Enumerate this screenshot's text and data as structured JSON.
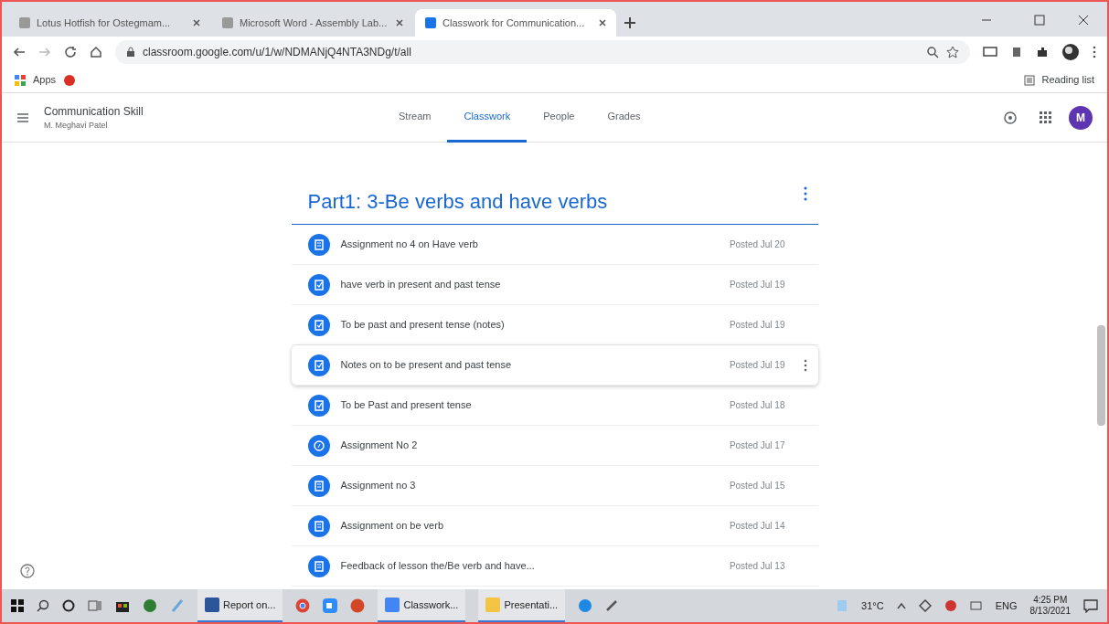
{
  "browser": {
    "tabs": [
      {
        "title": "Lotus Hotfish for Ostegmam...",
        "selected": false
      },
      {
        "title": "Microsoft Word - Assembly Lab...",
        "selected": false
      },
      {
        "title": "Classwork for Communication...",
        "selected": true
      }
    ],
    "url": "classroom.google.com/u/1/w/NDMANjQ4NTA3NDg/t/all",
    "bookmarks": [
      {
        "label": "Apps"
      }
    ],
    "reading_list": "Reading list"
  },
  "class": {
    "title": "Communication Skill",
    "subtitle": "M. Meghavi Patel",
    "avatar": "M",
    "tabs": [
      {
        "label": "Stream",
        "selected": false
      },
      {
        "label": "Classwork",
        "selected": true
      },
      {
        "label": "People",
        "selected": false
      },
      {
        "label": "Grades",
        "selected": false
      }
    ]
  },
  "topic": {
    "title": "Part1: 3-Be verbs and have verbs",
    "items": [
      {
        "kind": "assignment",
        "title": "Assignment no 4 on Have verb",
        "posted": "Posted Jul 20",
        "highlighted": false
      },
      {
        "kind": "material",
        "title": "have verb in present and past tense",
        "posted": "Posted Jul 19",
        "highlighted": false
      },
      {
        "kind": "material",
        "title": "To be past and present tense (notes)",
        "posted": "Posted Jul 19",
        "highlighted": false
      },
      {
        "kind": "material",
        "title": "Notes on to be present and past tense",
        "posted": "Posted Jul 19",
        "highlighted": true
      },
      {
        "kind": "material",
        "title": "To be Past and present tense",
        "posted": "Posted Jul 18",
        "highlighted": false
      },
      {
        "kind": "question",
        "title": "Assignment No 2",
        "posted": "Posted Jul 17",
        "highlighted": false
      },
      {
        "kind": "assignment",
        "title": "Assignment no 3",
        "posted": "Posted Jul 15",
        "highlighted": false
      },
      {
        "kind": "assignment",
        "title": "Assignment on be verb",
        "posted": "Posted Jul 14",
        "highlighted": false
      },
      {
        "kind": "assignment",
        "title": "Feedback of lesson the/Be verb and have...",
        "posted": "Posted Jul 13",
        "highlighted": false
      }
    ]
  },
  "taskbar": {
    "apps": [
      {
        "label": "Report on..."
      },
      {
        "label": "Classwork..."
      },
      {
        "label": "Presentati..."
      }
    ],
    "temperature": "31°C",
    "language": "ENG",
    "time": "4:25 PM",
    "date": "8/13/2021"
  }
}
